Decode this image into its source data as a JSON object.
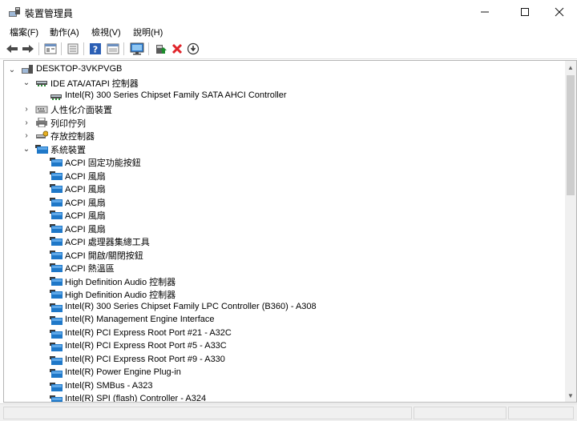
{
  "window": {
    "title": "裝置管理員",
    "app_icon": "device-manager-icon"
  },
  "menu": [
    "檔案(F)",
    "動作(A)",
    "檢視(V)",
    "說明(H)"
  ],
  "toolbar": {
    "buttons": [
      "back-icon",
      "forward-icon",
      "properties-icon",
      "show-hide-icon",
      "help-icon",
      "action-view-icon",
      "monitor-scan-icon",
      "update-driver-icon",
      "uninstall-icon",
      "download-icon"
    ]
  },
  "tree": {
    "root": "DESKTOP-3VKPVGB",
    "nodes": [
      {
        "label": "IDE ATA/ATAPI 控制器",
        "level": 1,
        "expanded": true,
        "icon": "ide-controller-icon"
      },
      {
        "label": "Intel(R) 300 Series Chipset Family SATA AHCI Controller",
        "level": 2,
        "icon": "ide-controller-icon"
      },
      {
        "label": "人性化介面裝置",
        "level": 1,
        "expanded": false,
        "icon": "hid-icon"
      },
      {
        "label": "列印佇列",
        "level": 1,
        "expanded": false,
        "icon": "printer-icon"
      },
      {
        "label": "存放控制器",
        "level": 1,
        "expanded": false,
        "icon": "storage-controller-icon"
      },
      {
        "label": "系統裝置",
        "level": 1,
        "expanded": true,
        "icon": "system-device-icon"
      },
      {
        "label": "ACPI 固定功能按鈕",
        "level": 2,
        "icon": "system-device-icon"
      },
      {
        "label": "ACPI 風扇",
        "level": 2,
        "icon": "system-device-icon"
      },
      {
        "label": "ACPI 風扇",
        "level": 2,
        "icon": "system-device-icon"
      },
      {
        "label": "ACPI 風扇",
        "level": 2,
        "icon": "system-device-icon"
      },
      {
        "label": "ACPI 風扇",
        "level": 2,
        "icon": "system-device-icon"
      },
      {
        "label": "ACPI 風扇",
        "level": 2,
        "icon": "system-device-icon"
      },
      {
        "label": "ACPI 處理器集總工具",
        "level": 2,
        "icon": "system-device-icon"
      },
      {
        "label": "ACPI 開啟/關閉按鈕",
        "level": 2,
        "icon": "system-device-icon"
      },
      {
        "label": "ACPI 熱溫區",
        "level": 2,
        "icon": "system-device-icon"
      },
      {
        "label": "High Definition Audio 控制器",
        "level": 2,
        "icon": "system-device-icon"
      },
      {
        "label": "High Definition Audio 控制器",
        "level": 2,
        "icon": "system-device-icon"
      },
      {
        "label": "Intel(R) 300 Series Chipset Family LPC Controller (B360) - A308",
        "level": 2,
        "icon": "system-device-icon"
      },
      {
        "label": "Intel(R) Management Engine Interface",
        "level": 2,
        "icon": "system-device-icon"
      },
      {
        "label": "Intel(R) PCI Express Root Port #21 - A32C",
        "level": 2,
        "icon": "system-device-icon"
      },
      {
        "label": "Intel(R) PCI Express Root Port #5 - A33C",
        "level": 2,
        "icon": "system-device-icon"
      },
      {
        "label": "Intel(R) PCI Express Root Port #9 - A330",
        "level": 2,
        "icon": "system-device-icon"
      },
      {
        "label": "Intel(R) Power Engine Plug-in",
        "level": 2,
        "icon": "system-device-icon"
      },
      {
        "label": "Intel(R) SMBus - A323",
        "level": 2,
        "icon": "system-device-icon"
      },
      {
        "label": "Intel(R) SPI (flash) Controller - A324",
        "level": 2,
        "icon": "system-device-icon"
      }
    ]
  },
  "colors": {
    "accent": "#2b7cd3",
    "uninstall": "#e0242a",
    "update": "#1c8c2c"
  }
}
